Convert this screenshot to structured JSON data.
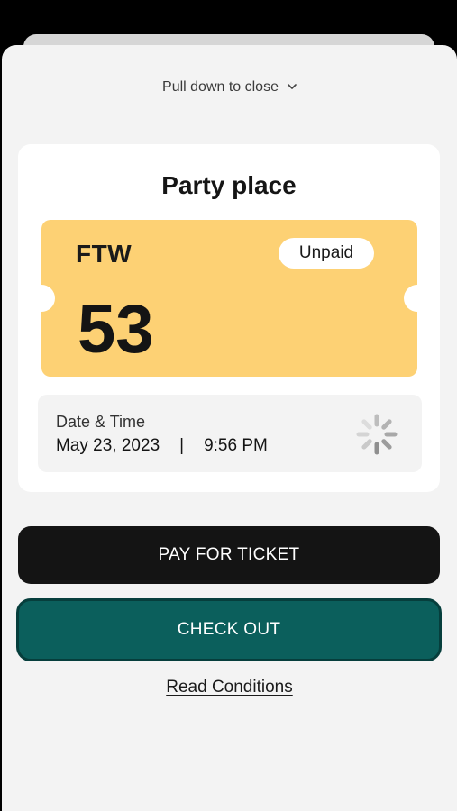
{
  "sheet": {
    "pull_label": "Pull down to close",
    "chevron_icon": "chevron-down-icon"
  },
  "card": {
    "title": "Party place",
    "ticket": {
      "code": "FTW",
      "status": "Unpaid",
      "number": "53",
      "color": "#fdd174"
    },
    "info": {
      "label": "Date & Time",
      "date": "May 23, 2023",
      "separator": "|",
      "time": "9:56 PM",
      "loading_icon": "loading-spinner-icon"
    }
  },
  "actions": {
    "pay_label": "PAY FOR TICKET",
    "checkout_label": "CHECK OUT",
    "conditions_label": "Read Conditions",
    "pay_color": "#141414",
    "checkout_color": "#0b5f5c"
  }
}
